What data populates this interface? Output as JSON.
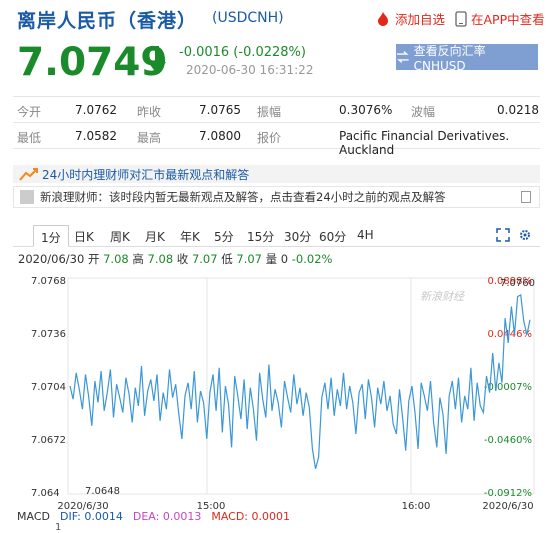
{
  "header": {
    "title": "离岸人民币（香港）",
    "code": "(USDCNH)",
    "add_watch": "添加自选",
    "view_app": "在APP中查看"
  },
  "quote_main": {
    "price": "7.0749",
    "change": "-0.0016 (-0.0228%)",
    "timestamp": "2020-06-30  16:31:22",
    "reverse_button": "查看反向汇率 CNHUSD"
  },
  "quote_table": {
    "row1": {
      "open_label": "今开",
      "open_value": "7.0762",
      "prev_label": "昨收",
      "prev_value": "7.0765",
      "amp_label": "振幅",
      "amp_value": "0.3076%",
      "wave_label": "波幅",
      "wave_value": "0.0218"
    },
    "row2": {
      "low_label": "最低",
      "low_value": "7.0582",
      "high_label": "最高",
      "high_value": "7.0800",
      "report_label": "报价",
      "report_value": "Pacific Financial Derivatives. Auckland"
    }
  },
  "news": {
    "bar_text": "24小时内理财师对汇市最新观点和解答",
    "item_text": "新浪理财师：该时段内暂无最新观点及解答，点击查看24小时之前的观点及解答"
  },
  "tabs": [
    "1分",
    "日K",
    "周K",
    "月K",
    "年K",
    "5分",
    "15分",
    "30分",
    "60分",
    "4H"
  ],
  "summary": {
    "date": "2020/06/30",
    "open_label": "开",
    "open": "7.08",
    "high_label": "高",
    "high": "7.08",
    "close_label": "收",
    "close": "7.07",
    "low_label": "低",
    "low": "7.07",
    "vol_label": "量",
    "vol": "0",
    "pct": "-0.02%"
  },
  "chart_data": {
    "type": "line",
    "y_ticks": [
      "7.0768",
      "7.0736",
      "7.0704",
      "7.0672",
      "7.064"
    ],
    "y_range": [
      7.064,
      7.0768
    ],
    "right_ticks": [
      "0.0898%",
      "0.0446%",
      "-0.0007%",
      "-0.0460%",
      "-0.0912%"
    ],
    "x_labels": [
      "2020/6/30",
      "15:00",
      "16:00",
      "2020/6/30"
    ],
    "max_label": "7.0760",
    "min_label": "7.0648",
    "watermark": "新浪财经",
    "color": "#3b97d6",
    "values": [
      7.0704,
      7.0696,
      7.0712,
      7.0702,
      7.069,
      7.0711,
      7.0698,
      7.068,
      7.0707,
      7.0694,
      7.0713,
      7.0689,
      7.07,
      7.0714,
      7.0685,
      7.0705,
      7.0697,
      7.0688,
      7.0709,
      7.0699,
      7.0682,
      7.0703,
      7.0692,
      7.0716,
      7.0686,
      7.0701,
      7.0708,
      7.0695,
      7.0711,
      7.0683,
      7.07,
      7.069,
      7.0714,
      7.0697,
      7.0705,
      7.0687,
      7.0672,
      7.0698,
      7.0706,
      7.069,
      7.0713,
      7.0682,
      7.0701,
      7.0694,
      7.0672,
      7.07,
      7.0711,
      7.0689,
      7.0715,
      7.0676,
      7.0704,
      7.0693,
      7.0667,
      7.071,
      7.0698,
      7.0684,
      7.0708,
      7.0678,
      7.0703,
      7.069,
      7.0671,
      7.0712,
      7.0696,
      7.0685,
      7.0717,
      7.0689,
      7.0702,
      7.0694,
      7.0679,
      7.0707,
      7.0697,
      7.0688,
      7.0711,
      7.0693,
      7.0703,
      7.0686,
      7.07,
      7.0691,
      7.0666,
      7.0654,
      7.0661,
      7.0697,
      7.0706,
      7.069,
      7.0709,
      7.0686,
      7.0702,
      7.0692,
      7.0712,
      7.069,
      7.0704,
      7.0694,
      7.0675,
      7.07,
      7.0705,
      7.0684,
      7.0708,
      7.0697,
      7.0679,
      7.0703,
      7.0693,
      7.0707,
      7.0689,
      7.0698,
      7.0681,
      7.0675,
      7.0702,
      7.0685,
      7.0665,
      7.0695,
      7.0704,
      7.0688,
      7.0666,
      7.0706,
      7.0698,
      7.0689,
      7.0707,
      7.0682,
      7.0667,
      7.0697,
      7.0687,
      7.0663,
      7.0698,
      7.0707,
      7.069,
      7.0709,
      7.0682,
      7.0698,
      7.069,
      7.0715,
      7.0683,
      7.0706,
      7.0692,
      7.0688,
      7.071,
      7.07,
      7.0724,
      7.0701,
      7.0718,
      7.0706,
      7.0745,
      7.073,
      7.0752,
      7.0735,
      7.0758,
      7.0759,
      7.0743,
      7.0735,
      7.0744
    ]
  },
  "macd": {
    "label": "MACD",
    "dif": "DIF: 0.0014",
    "dea": "DEA: 0.0013",
    "macd": "MACD: 0.0001",
    "dif_color": "#1a5aa6",
    "dea_color": "#c646c2",
    "macd_color": "#e0281b",
    "axis_label": "1"
  }
}
